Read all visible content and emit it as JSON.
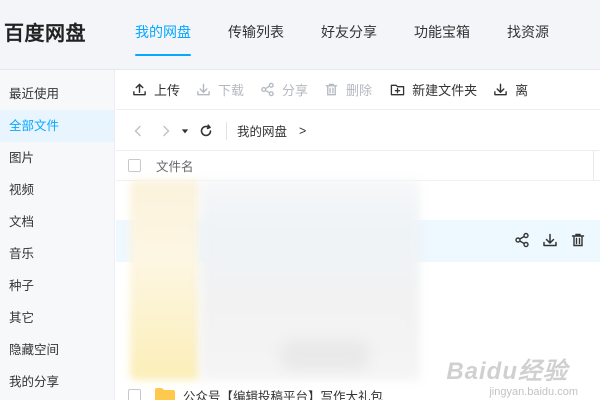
{
  "app": {
    "logo": "百度网盘"
  },
  "nav": {
    "items": [
      {
        "label": "我的网盘",
        "active": true
      },
      {
        "label": "传输列表",
        "active": false
      },
      {
        "label": "好友分享",
        "active": false
      },
      {
        "label": "功能宝箱",
        "active": false
      },
      {
        "label": "找资源",
        "active": false
      }
    ]
  },
  "sidebar": {
    "items": [
      {
        "label": "最近使用"
      },
      {
        "label": "全部文件",
        "active": true
      },
      {
        "label": "图片"
      },
      {
        "label": "视频"
      },
      {
        "label": "文档"
      },
      {
        "label": "音乐"
      },
      {
        "label": "种子"
      },
      {
        "label": "其它"
      },
      {
        "label": "隐藏空间"
      },
      {
        "label": "我的分享"
      }
    ]
  },
  "toolbar": {
    "upload": "上传",
    "download": "下载",
    "share": "分享",
    "delete": "删除",
    "new_folder": "新建文件夹",
    "offline": "离"
  },
  "pathbar": {
    "current": "我的网盘",
    "separator": ">"
  },
  "table": {
    "header_name": "文件名",
    "last_row_name": "公众号【编辑投稿平台】写作大礼包"
  },
  "watermark": {
    "text": "Baidu经验",
    "sub": "jingyan.baidu.com"
  },
  "colors": {
    "accent": "#06a7ff",
    "hover_row": "#eef8ff",
    "disabled": "#b4b8c0"
  }
}
